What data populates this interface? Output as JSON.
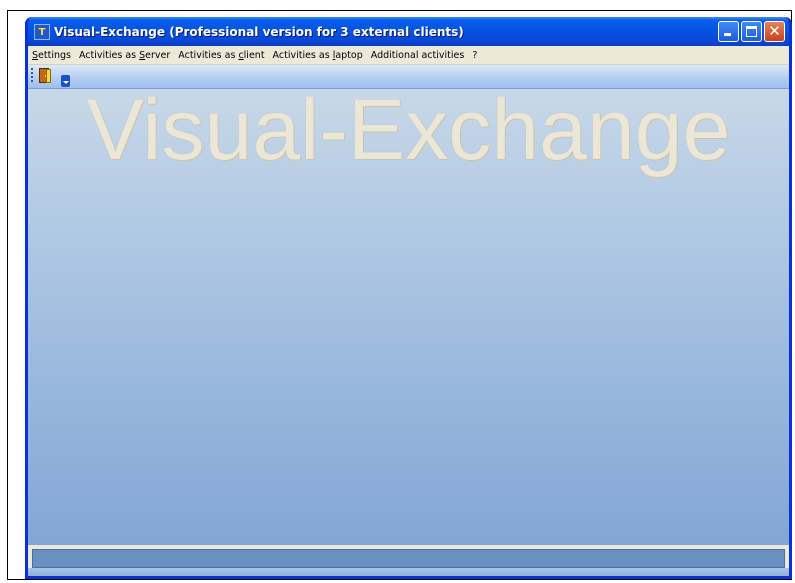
{
  "window": {
    "title": "Visual-Exchange (Professional version for 3 external clients)",
    "icon": "app-icon",
    "icon_glyph": "T "
  },
  "menubar": {
    "items": [
      {
        "pre": "",
        "accel": "S",
        "post": "ettings"
      },
      {
        "pre": "Activities as ",
        "accel": "S",
        "post": "erver"
      },
      {
        "pre": "Activities as ",
        "accel": "c",
        "post": "lient"
      },
      {
        "pre": "Activities as ",
        "accel": "l",
        "post": "aptop"
      },
      {
        "pre": "Additional activities",
        "accel": "",
        "post": ""
      },
      {
        "pre": "?",
        "accel": "",
        "post": ""
      }
    ]
  },
  "toolbar": {
    "items": [
      {
        "icon": "exit-door-icon"
      },
      {
        "icon": "toolbar-overflow-icon"
      }
    ]
  },
  "desktop": {
    "watermark": "Visual-Exchange"
  },
  "colors": {
    "titlebar": "#0a5ded",
    "desktop_top": "#c7d8e8",
    "desktop_bottom": "#82a6d4",
    "watermark": "#ebe6d6",
    "status_panel": "#6a8fc1"
  }
}
